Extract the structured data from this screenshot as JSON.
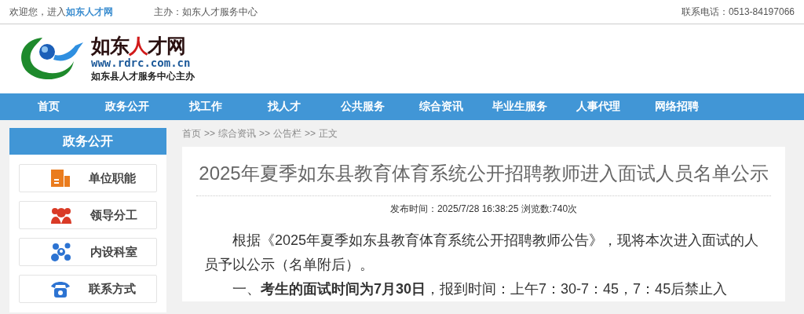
{
  "top_bar": {
    "welcome": "欢迎您，进入",
    "site_link": "如东人才网",
    "host": "主办：如东人才服务中心",
    "phone": "联系电话：0513-84197066"
  },
  "logo": {
    "title_parts": [
      {
        "text": "如东",
        "kind": "normal"
      },
      {
        "text": "人",
        "kind": "accent"
      },
      {
        "text": "才网",
        "kind": "normal"
      }
    ],
    "url": "www.rdrc.com.cn",
    "subtitle": "如东县人才服务中心主办"
  },
  "nav": [
    {
      "label": "首页",
      "selected": false
    },
    {
      "label": "政务公开",
      "selected": false
    },
    {
      "label": "找工作",
      "selected": false
    },
    {
      "label": "找人才",
      "selected": false
    },
    {
      "label": "公共服务",
      "selected": false
    },
    {
      "label": "综合资讯",
      "selected": false
    },
    {
      "label": "毕业生服务",
      "selected": false
    },
    {
      "label": "人事代理",
      "selected": false
    },
    {
      "label": "网络招聘",
      "selected": false
    }
  ],
  "sidebar": {
    "title": "政务公开",
    "items": [
      {
        "label": "单位职能",
        "kind": "building"
      },
      {
        "label": "领导分工",
        "kind": "people"
      },
      {
        "label": "内设科室",
        "kind": "network"
      },
      {
        "label": "联系方式",
        "kind": "phone"
      }
    ]
  },
  "breadcrumb": [
    "首页",
    ">>",
    "综合资讯",
    ">>",
    "公告栏",
    ">>",
    "正文"
  ],
  "article": {
    "title": "2025年夏季如东县教育体育系统公开招聘教师进入面试人员名单公示",
    "meta": "发布时间：2025/7/28 16:38:25 浏览数:740次",
    "paragraphs": [
      "根据《2025年夏季如东县教育体育系统公开招聘教师公告》，现将本次进入面试的人员予以公示（名单附后）。",
      "一、**考生的面试时间为7月30日**，报到时间：上午7：30-7：45，7：45后禁止入"
    ]
  }
}
